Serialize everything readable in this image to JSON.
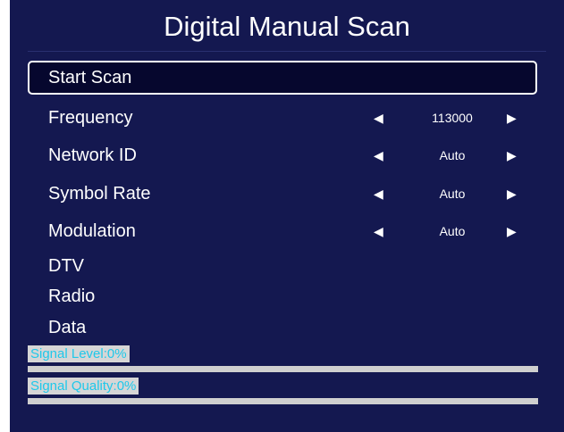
{
  "title": "Digital Manual Scan",
  "menu": {
    "start_scan": "Start Scan",
    "frequency": {
      "label": "Frequency",
      "value": "113000"
    },
    "network_id": {
      "label": "Network ID",
      "value": "Auto"
    },
    "symbol_rate": {
      "label": "Symbol Rate",
      "value": "Auto"
    },
    "modulation": {
      "label": "Modulation",
      "value": "Auto"
    },
    "dtv": "DTV",
    "radio": "Radio",
    "data": "Data"
  },
  "arrows": {
    "left": "◀",
    "right": "▶"
  },
  "signal": {
    "level_label": "Signal Level:0%",
    "level_percent": 0,
    "quality_label": "Signal Quality:0%",
    "quality_percent": 0
  },
  "colors": {
    "background": "#141850",
    "accent": "#1fc8ea",
    "bar": "#cfcfcf"
  }
}
